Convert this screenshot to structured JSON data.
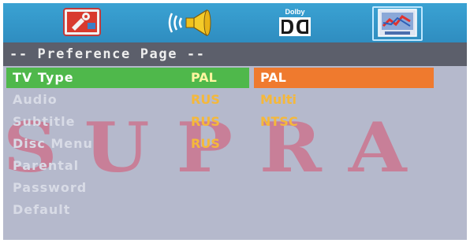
{
  "tabs": [
    {
      "name": "system-setup",
      "icon": "toolbox-icon"
    },
    {
      "name": "audio-setup",
      "icon": "speaker-icon"
    },
    {
      "name": "dolby-setup",
      "icon": "dolby-icon",
      "label": "Dolby"
    },
    {
      "name": "preference-setup",
      "icon": "preference-icon",
      "selected": true
    }
  ],
  "page_title": "-- Preference Page --",
  "watermark": "SUPRA",
  "menu": [
    {
      "label": "TV Type",
      "value": "PAL",
      "active": true
    },
    {
      "label": "Audio",
      "value": "RUS"
    },
    {
      "label": "Subtitle",
      "value": "RUS"
    },
    {
      "label": "Disc Menu",
      "value": "RUS"
    },
    {
      "label": "Parental",
      "value": ""
    },
    {
      "label": "Password",
      "value": ""
    },
    {
      "label": "Default",
      "value": ""
    }
  ],
  "options": [
    {
      "label": "PAL",
      "selected": true
    },
    {
      "label": "Multi"
    },
    {
      "label": "NTSC"
    }
  ],
  "colors": {
    "tabbar": "#3aa2d3",
    "header": "#5c5f6b",
    "background": "#b5b9cc",
    "highlight_row": "#4fb84b",
    "highlight_option": "#ef7a2e",
    "value_text": "#f5b83a",
    "watermark": "#e03a5a"
  }
}
